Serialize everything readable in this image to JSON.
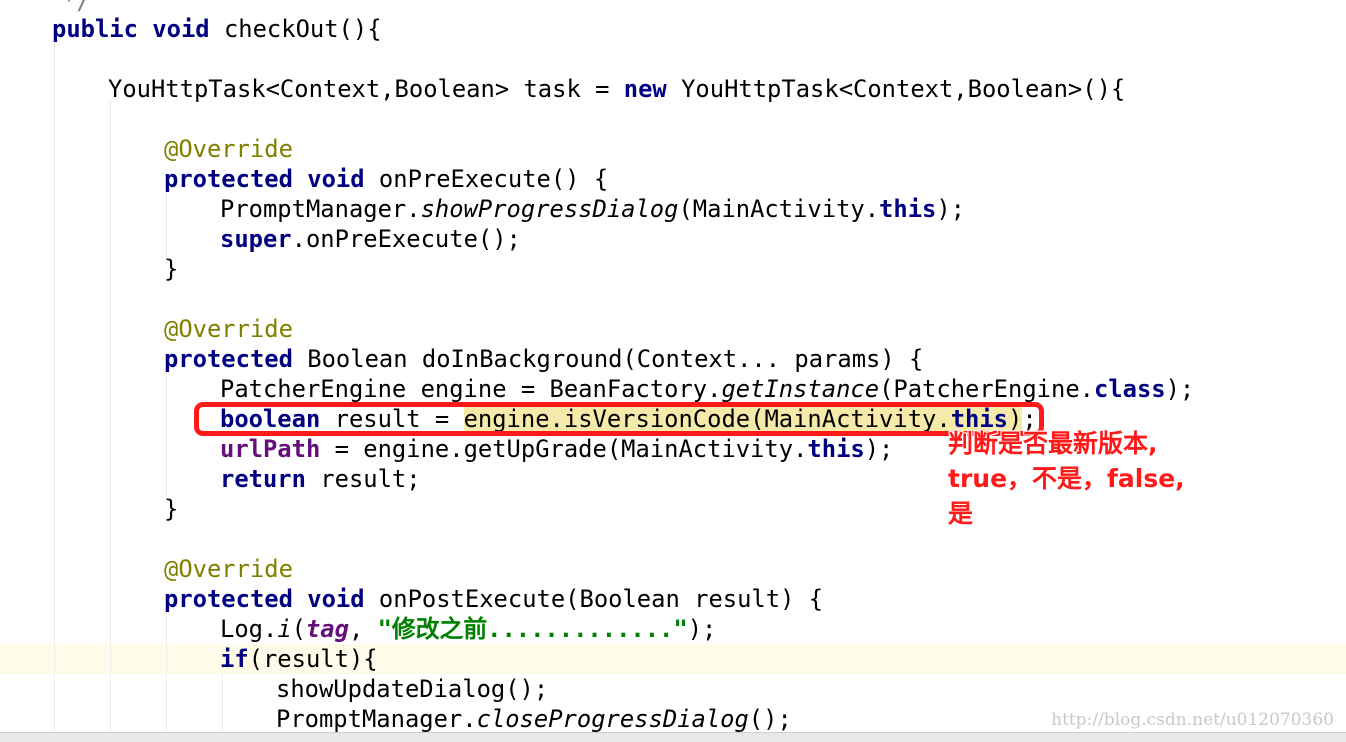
{
  "code": {
    "comment_tail": "*/",
    "l1": {
      "kw1": "public",
      "kw2": "void",
      "rest": "checkOut(){"
    },
    "l2": {
      "a": "YouHttpTask<Context,Boolean> task = ",
      "kw": "new",
      "b": "YouHttpTask<Context,Boolean>(){"
    },
    "override": "@Override",
    "pre": {
      "kw1": "protected",
      "kw2": "void",
      "rest": "onPreExecute() {"
    },
    "pre_body1": {
      "a": "PromptManager.",
      "m": "showProgressDialog",
      "b": "(MainActivity.",
      "kw": "this",
      "c": ");"
    },
    "pre_body2": {
      "kw": "super",
      "rest": ".onPreExecute();"
    },
    "close_brace": "}",
    "bg": {
      "kw": "protected",
      "rest": "Boolean doInBackground(Context... params) {"
    },
    "bg_body1": {
      "a": "PatcherEngine engine = BeanFactory.",
      "m": "getInstance",
      "b": "(PatcherEngine.",
      "kw": "class",
      "c": ");"
    },
    "bg_body2": {
      "kw": "boolean",
      "a": "result = ",
      "hl": "engine.isVersionCode(MainActivity.",
      "hlkw": "this",
      "hlc": ")",
      "c": ";"
    },
    "bg_body3": {
      "f": "urlPath",
      "a": " = engine.getUpGrade(MainActivity.",
      "kw": "this",
      "c": ");"
    },
    "bg_body4": {
      "kw": "return",
      "rest": "result;"
    },
    "post": {
      "kw1": "protected",
      "kw2": "void",
      "rest": "onPostExecute(Boolean result) {"
    },
    "post_body1": {
      "a": "Log.",
      "m": "i",
      "b": "(",
      "f": "tag",
      "c": ", ",
      "s": "\"修改之前.............\"",
      "d": ");"
    },
    "post_body2": {
      "kw": "if",
      "rest": "(result){"
    },
    "post_body3": "showUpdateDialog();",
    "post_body4": {
      "a": "PromptManager.",
      "m": "closeProgressDialog",
      "b": "();"
    }
  },
  "annotation": {
    "line1": "判断是否最新版本,",
    "line2": "true，不是，false,",
    "line3": "是",
    "color": "#ff1a1a"
  },
  "watermark": "http://blog.csdn.net/u012070360"
}
